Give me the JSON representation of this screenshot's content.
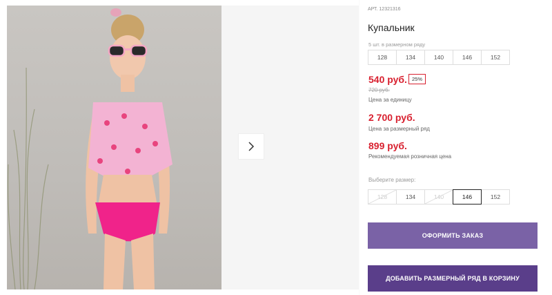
{
  "product": {
    "article": "АРТ. 12321316",
    "title": "Купальник",
    "row_label": "5 шт. в размерном ряду",
    "row_sizes": [
      "128",
      "134",
      "140",
      "146",
      "152"
    ],
    "price": "540 руб.",
    "discount": "25%",
    "old_price": "720 руб.",
    "unit_note": "Цена за единицу",
    "row_price": "2 700 руб.",
    "row_price_note": "Цена за размерный ряд",
    "retail_price": "899 руб.",
    "retail_note": "Рекомендуемая розничная цена",
    "choose_label": "Выберите размер:",
    "choose_sizes": [
      {
        "label": "128",
        "state": "disabled"
      },
      {
        "label": "134",
        "state": "available"
      },
      {
        "label": "140",
        "state": "disabled"
      },
      {
        "label": "146",
        "state": "selected"
      },
      {
        "label": "152",
        "state": "available"
      }
    ],
    "order_button": "ОФОРМИТЬ ЗАКАЗ",
    "cart_button": "ДОБАВИТЬ РАЗМЕРНЫЙ РЯД В КОРЗИНУ"
  },
  "gallery": {
    "next_icon": "chevron-right-icon"
  },
  "colors": {
    "price_red": "#d8202f",
    "order_button": "#7a62a6",
    "cart_button": "#5a3e8a"
  }
}
